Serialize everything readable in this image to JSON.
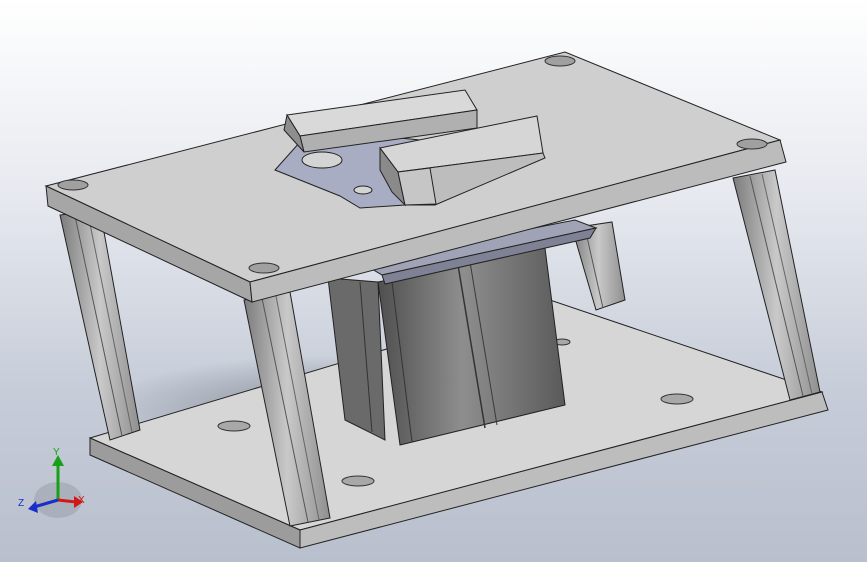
{
  "view": {
    "background_top": "#ffffff",
    "background_bottom": "#b9c0cd"
  },
  "colors": {
    "part_face_light": "#d9d9d9",
    "part_face_mid": "#bdbdbd",
    "part_face_dark": "#8f8f8f",
    "part_edge": "#222222",
    "plate_blue": "#a9adc4",
    "cylinder_light": "#8a8a8a",
    "cylinder_dark": "#5e5e5e"
  },
  "triad": {
    "x_label": "X",
    "y_label": "Y",
    "z_label": "Z",
    "x_color": "#d01818",
    "y_color": "#18a018",
    "z_color": "#1830c8"
  }
}
